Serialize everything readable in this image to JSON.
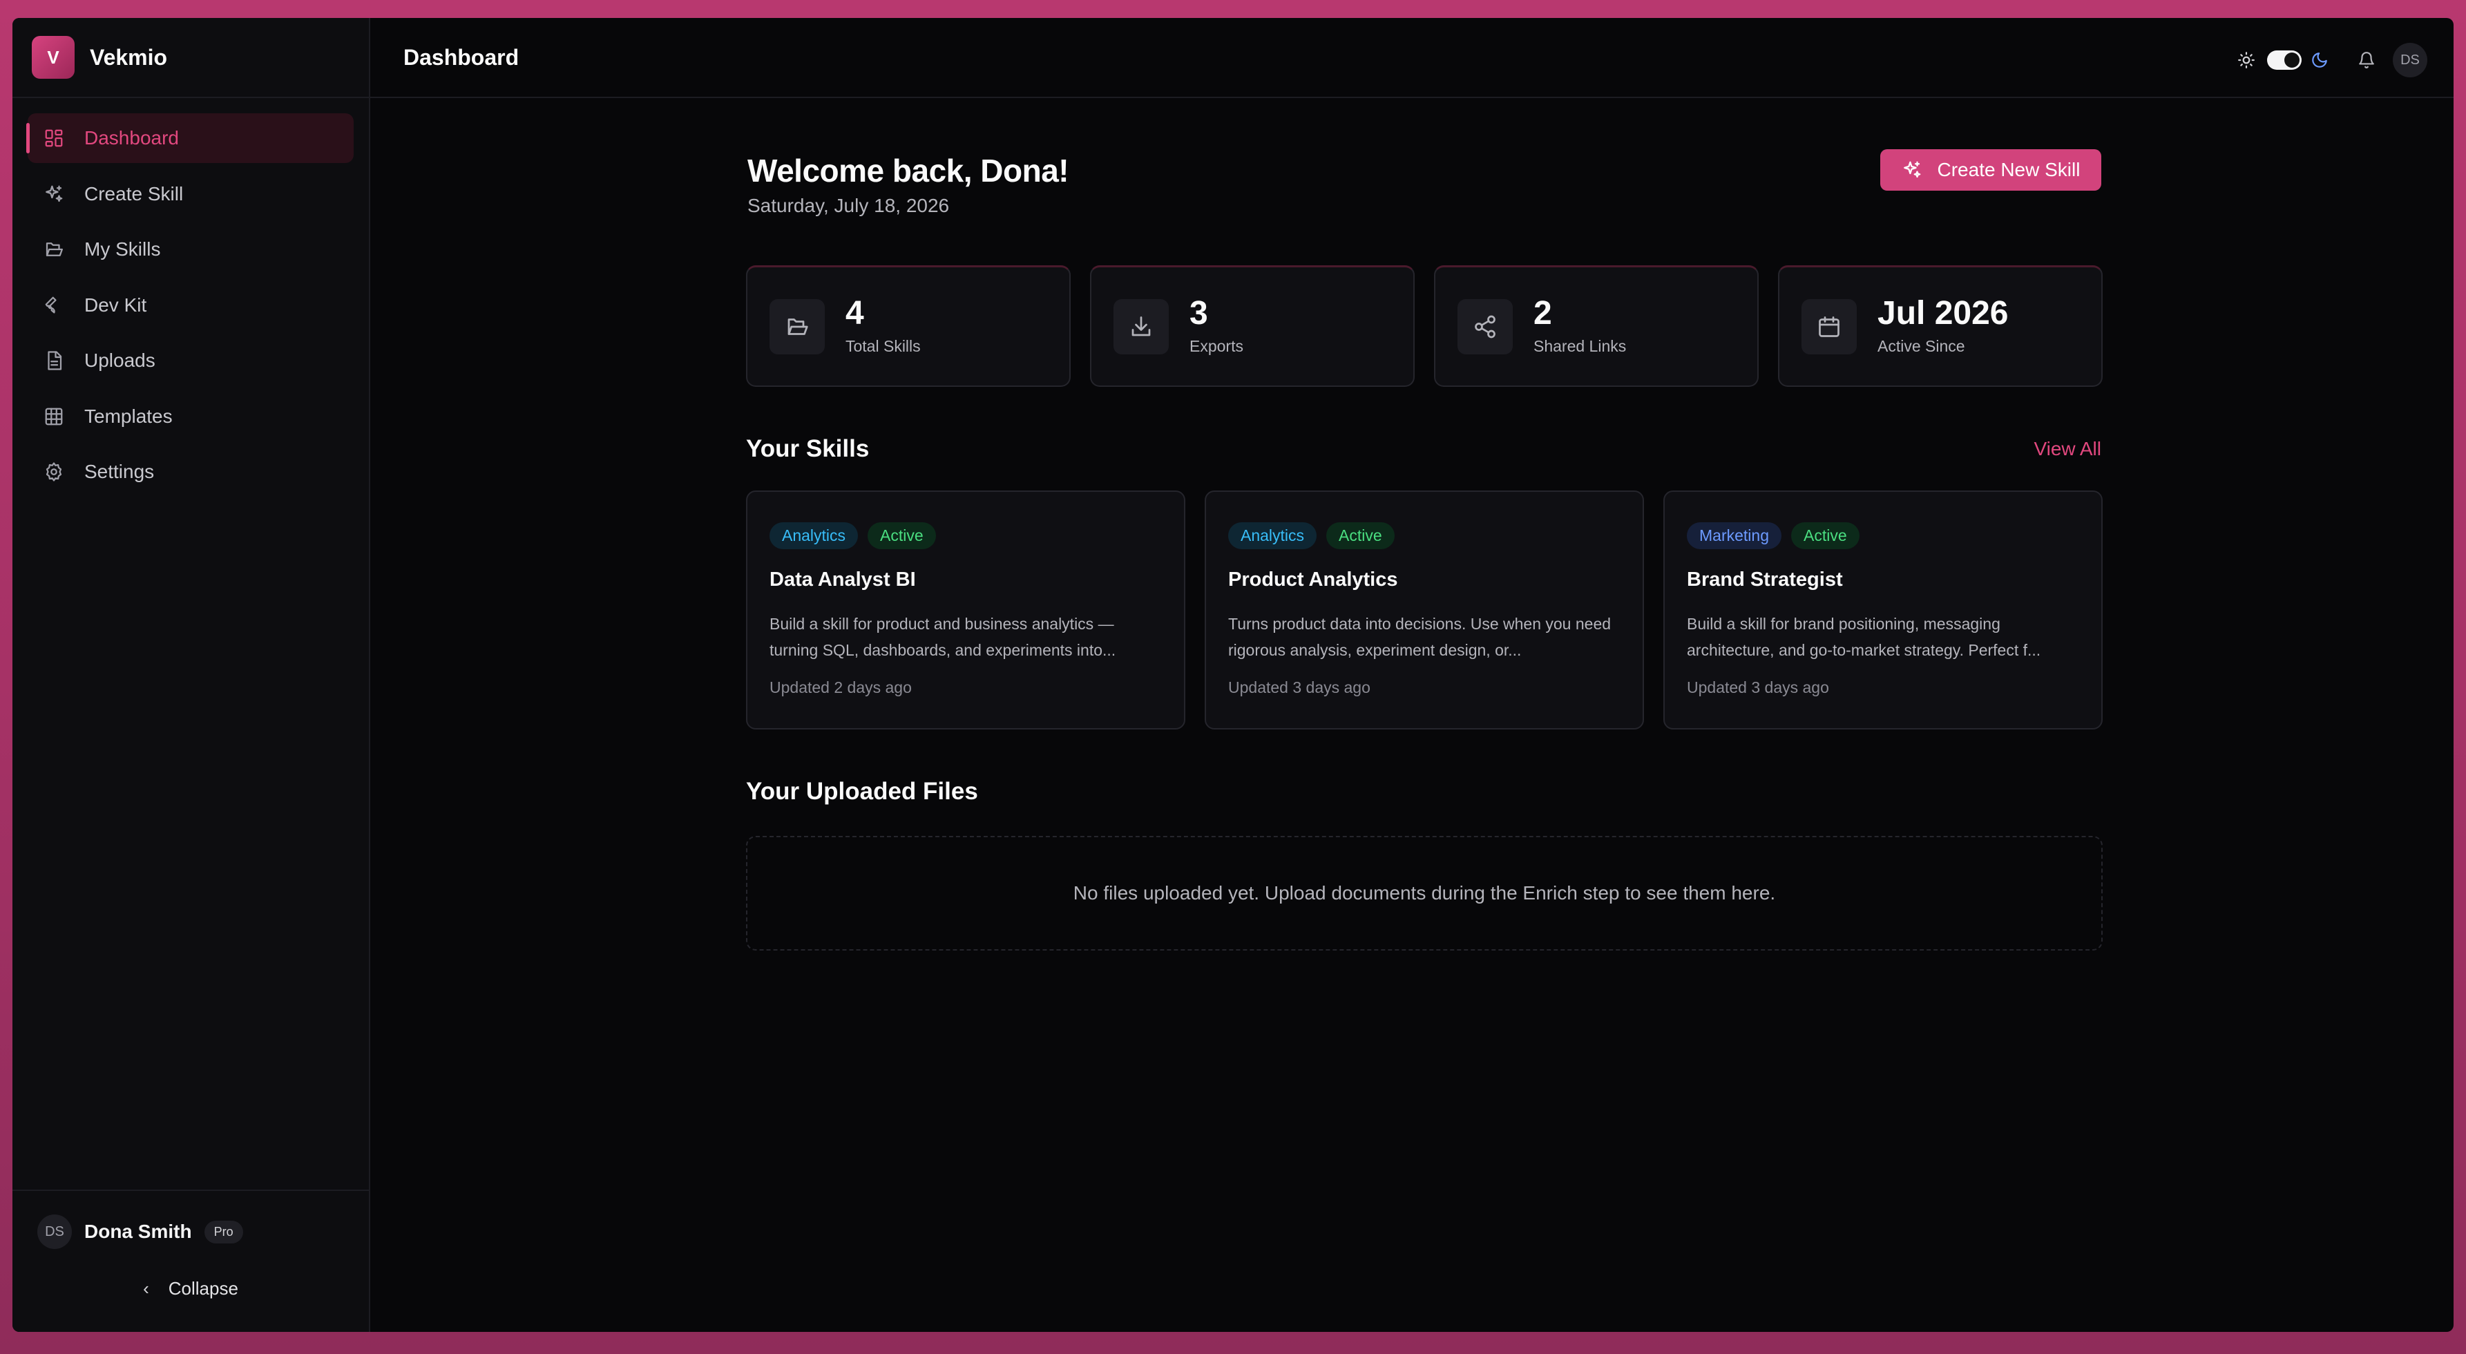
{
  "brand": {
    "logo_letter": "V",
    "name": "Vekmio"
  },
  "sidebar": {
    "items": [
      {
        "label": "Dashboard",
        "icon": "dashboard-icon",
        "active": true
      },
      {
        "label": "Create Skill",
        "icon": "sparkles-icon"
      },
      {
        "label": "My Skills",
        "icon": "folder-open-icon"
      },
      {
        "label": "Dev Kit",
        "icon": "wrench-icon"
      },
      {
        "label": "Uploads",
        "icon": "file-icon"
      },
      {
        "label": "Templates",
        "icon": "grid-icon"
      },
      {
        "label": "Settings",
        "icon": "gear-icon"
      }
    ],
    "user": {
      "initials": "DS",
      "name": "Dona Smith",
      "plan": "Pro"
    },
    "collapse_label": "Collapse"
  },
  "topbar": {
    "title": "Dashboard",
    "avatar_initials": "DS"
  },
  "welcome": {
    "heading": "Welcome back, Dona!",
    "date": "Saturday, July 18, 2026"
  },
  "create_button": {
    "label": "Create New Skill"
  },
  "stats": [
    {
      "value": "4",
      "label": "Total Skills",
      "icon": "folder-open-icon"
    },
    {
      "value": "3",
      "label": "Exports",
      "icon": "download-icon"
    },
    {
      "value": "2",
      "label": "Shared Links",
      "icon": "share-icon"
    },
    {
      "value": "Jul 2026",
      "label": "Active Since",
      "icon": "calendar-icon"
    }
  ],
  "skills_section": {
    "title": "Your Skills",
    "view_all": "View All"
  },
  "skills": [
    {
      "category": "Analytics",
      "status": "Active",
      "title": "Data Analyst BI",
      "description": "Build a skill for product and business analytics — turning SQL, dashboards, and experiments into...",
      "updated": "Updated 2 days ago"
    },
    {
      "category": "Analytics",
      "status": "Active",
      "title": "Product Analytics",
      "description": "Turns product data into decisions. Use when you need rigorous analysis, experiment design, or...",
      "updated": "Updated 3 days ago"
    },
    {
      "category": "Marketing",
      "status": "Active",
      "title": "Brand Strategist",
      "description": "Build a skill for brand positioning, messaging architecture, and go-to-market strategy. Perfect f...",
      "updated": "Updated 3 days ago"
    }
  ],
  "files_section": {
    "title": "Your Uploaded Files",
    "empty_text": "No files uploaded yet. Upload documents during the Enrich step to see them here."
  },
  "colors": {
    "accent": "#e2487f",
    "background": "#070709",
    "sidebar": "#0d0d10",
    "card": "#0f0f13"
  }
}
